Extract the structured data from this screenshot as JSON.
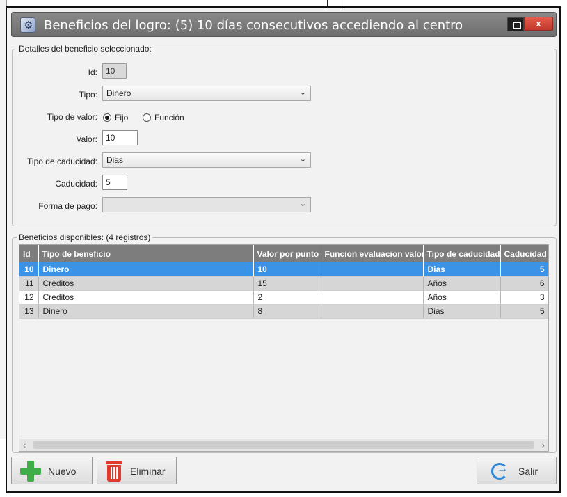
{
  "dialog": {
    "title": "Beneficios del logro: (5) 10 días consecutivos accediendo al centro",
    "close_label": "x"
  },
  "details": {
    "legend": "Detalles del beneficio seleccionado:",
    "id_label": "Id:",
    "id_value": "10",
    "tipo_label": "Tipo:",
    "tipo_value": "Dinero",
    "tipo_valor_label": "Tipo de valor:",
    "radio_fijo": "Fijo",
    "radio_funcion": "Función",
    "radio_selected": "Fijo",
    "valor_label": "Valor:",
    "valor_value": "10",
    "tipo_caducidad_label": "Tipo de caducidad:",
    "tipo_caducidad_value": "Dias",
    "caducidad_label": "Caducidad:",
    "caducidad_value": "5",
    "forma_pago_label": "Forma de pago:",
    "forma_pago_value": ""
  },
  "available": {
    "legend": "Beneficios disponibles:  (4 registros)",
    "columns": [
      "Id",
      "Tipo de beneficio",
      "Valor por punto",
      "Funcion evaluacion valor",
      "Tipo de caducidad",
      "Caducidad"
    ],
    "rows": [
      [
        "10",
        "Dinero",
        "10",
        "",
        "Dias",
        "5"
      ],
      [
        "11",
        "Creditos",
        "15",
        "",
        "Años",
        "6"
      ],
      [
        "12",
        "Creditos",
        "2",
        "",
        "Años",
        "3"
      ],
      [
        "13",
        "Dinero",
        "8",
        "",
        "Dias",
        "5"
      ]
    ],
    "selected_row_index": 0
  },
  "buttons": {
    "new_label": "Nuevo",
    "delete_label": "Eliminar",
    "exit_label": "Salir"
  },
  "colors": {
    "selection": "#3a93e6",
    "header": "#7d7d7d",
    "close": "#c0392b"
  }
}
